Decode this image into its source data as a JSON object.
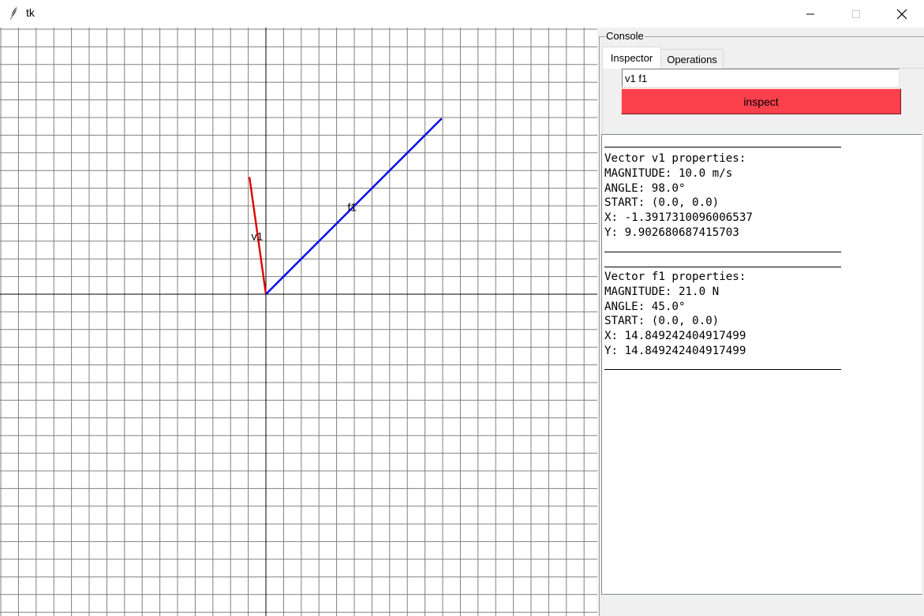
{
  "window": {
    "title": "tk",
    "buttons": {
      "minimize": "minimize-icon",
      "maximize": "maximize-icon",
      "close": "close-icon"
    }
  },
  "canvas": {
    "grid_color": "#808080",
    "axis_color": "#000000",
    "vectors": [
      {
        "label": "v1",
        "color": "#e00000",
        "magnitude": 10.0,
        "angle": 98.0
      },
      {
        "label": "f1",
        "color": "#0000ee",
        "magnitude": 21.0,
        "angle": 45.0
      }
    ]
  },
  "console": {
    "legend": "Console",
    "tabs": [
      {
        "label": "Inspector",
        "selected": true
      },
      {
        "label": "Operations",
        "selected": false
      }
    ],
    "inspector": {
      "input_value": "v1 f1",
      "button_label": "inspect",
      "button_color": "#fc404c"
    },
    "output": [
      {
        "heading": "Vector v1 properties:",
        "magnitude": "MAGNITUDE: 10.0 m/s",
        "angle": "ANGLE: 98.0°",
        "start": "START: (0.0, 0.0)",
        "x": "X: -1.3917310096006537",
        "y": "Y: 9.902680687415703"
      },
      {
        "heading": "Vector f1 properties:",
        "magnitude": "MAGNITUDE: 21.0 N",
        "angle": "ANGLE: 45.0°",
        "start": "START: (0.0, 0.0)",
        "x": "X: 14.849242404917499",
        "y": "Y: 14.849242404917499"
      }
    ]
  }
}
